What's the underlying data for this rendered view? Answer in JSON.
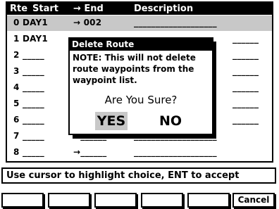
{
  "header": {
    "col_rte": "Rte",
    "col_start": "Start",
    "col_end": "→ End",
    "col_desc": "Description"
  },
  "routes": [
    {
      "num": "0",
      "start": "DAY1",
      "end": "→ 002",
      "desc": "___________________"
    },
    {
      "num": "1",
      "start": "DAY1",
      "end": "",
      "desc": "______"
    },
    {
      "num": "2",
      "start": "_____",
      "end": "",
      "desc": "______"
    },
    {
      "num": "3",
      "start": "_____",
      "end": "",
      "desc": "______"
    },
    {
      "num": "4",
      "start": "_____",
      "end": "",
      "desc": "______"
    },
    {
      "num": "5",
      "start": "_____",
      "end": "",
      "desc": "______"
    },
    {
      "num": "6",
      "start": "_____",
      "end": "",
      "desc": "______"
    },
    {
      "num": "7",
      "start": "_____",
      "end": "→______",
      "desc": "___________________"
    },
    {
      "num": "8",
      "start": "_____",
      "end": "→______",
      "desc": "___________________"
    }
  ],
  "modal": {
    "title": "Delete Route",
    "note_lines": [
      "NOTE: This will not delete",
      "route waypoints from the",
      "waypoint list."
    ],
    "question": "Are You Sure?",
    "yes_label": "YES",
    "no_label": "NO"
  },
  "status_text": "Use cursor to highlight choice, ENT to accept",
  "softkeys": [
    "",
    "",
    "",
    "",
    "",
    "Cancel"
  ]
}
